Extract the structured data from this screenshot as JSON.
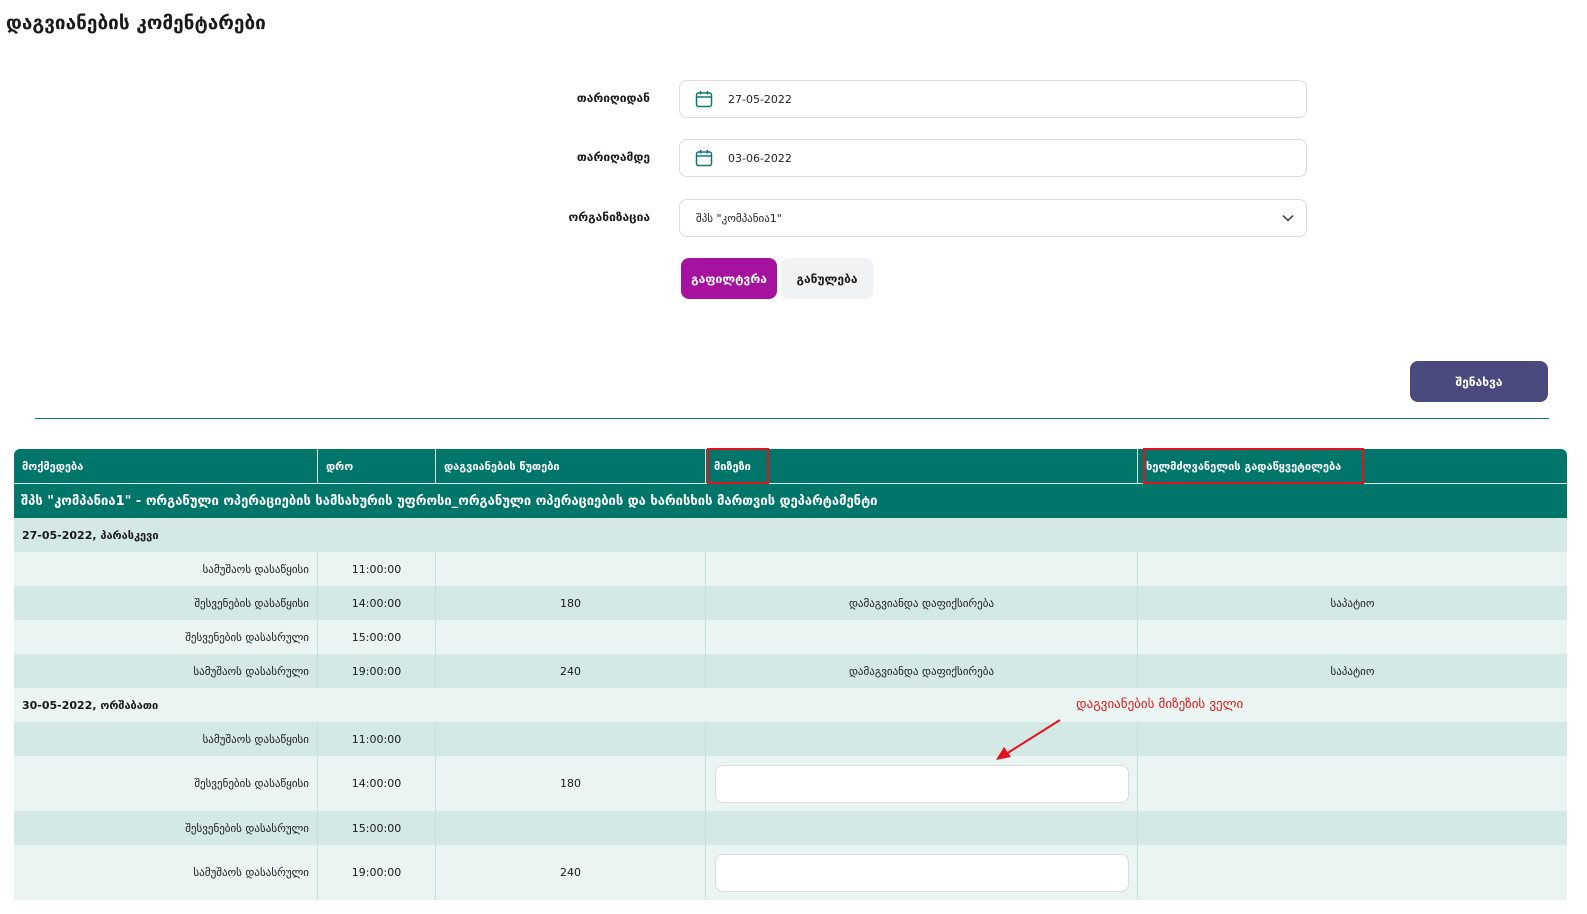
{
  "page": {
    "title": "დაგვიანების კომენტარები"
  },
  "filters": {
    "date_from": {
      "label": "თარიღიდან",
      "value": "27-05-2022"
    },
    "date_to": {
      "label": "თარიღამდე",
      "value": "03-06-2022"
    },
    "organization": {
      "label": "ორგანიზაცია",
      "value": "შპს \"კომპანია1\""
    },
    "filter_button": "გაფილტვრა",
    "reset_button": "განულება"
  },
  "save_button": "შენახვა",
  "colors": {
    "primary": "#00756a",
    "filter": "#a5139e",
    "save": "#4a4a7f",
    "highlight": "#e0141e"
  },
  "table": {
    "columns": [
      "მოქმედება",
      "დრო",
      "დაგვიანების წუთები",
      "მიზეზი",
      "ხელმძღვანელის გადაწყვეტილება"
    ],
    "org_header": "შპს \"კომპანია1\" - ორგანული ოპერაციების სამსახურის უფროსი_ორგანული ოპერაციების და ხარისხის მართვის დეპარტამენტი",
    "groups": [
      {
        "date": "27-05-2022, პარასკევი",
        "rows": [
          {
            "action": "სამუშაოს დასაწყისი",
            "time": "11:00:00",
            "minutes": "",
            "reason": "",
            "decision": ""
          },
          {
            "action": "შესვენების დასაწყისი",
            "time": "14:00:00",
            "minutes": "180",
            "reason": "დამაგვიანდა დაფიქსირება",
            "decision": "საპატიო"
          },
          {
            "action": "შესვენების დასასრული",
            "time": "15:00:00",
            "minutes": "",
            "reason": "",
            "decision": ""
          },
          {
            "action": "სამუშაოს დასასრული",
            "time": "19:00:00",
            "minutes": "240",
            "reason": "დამაგვიანდა დაფიქსირება",
            "decision": "საპატიო"
          }
        ]
      },
      {
        "date": "30-05-2022, ორშაბათი",
        "rows": [
          {
            "action": "სამუშაოს დასაწყისი",
            "time": "11:00:00",
            "minutes": "",
            "reason": "",
            "decision": ""
          },
          {
            "action": "შესვენების დასაწყისი",
            "time": "14:00:00",
            "minutes": "180",
            "reason": "",
            "decision": ""
          },
          {
            "action": "შესვენების დასასრული",
            "time": "15:00:00",
            "minutes": "",
            "reason": "",
            "decision": ""
          },
          {
            "action": "სამუშაოს დასასრული",
            "time": "19:00:00",
            "minutes": "240",
            "reason": "",
            "decision": ""
          }
        ]
      }
    ]
  },
  "annotation": {
    "text": "დაგვიანების მიზეზის ველი"
  }
}
